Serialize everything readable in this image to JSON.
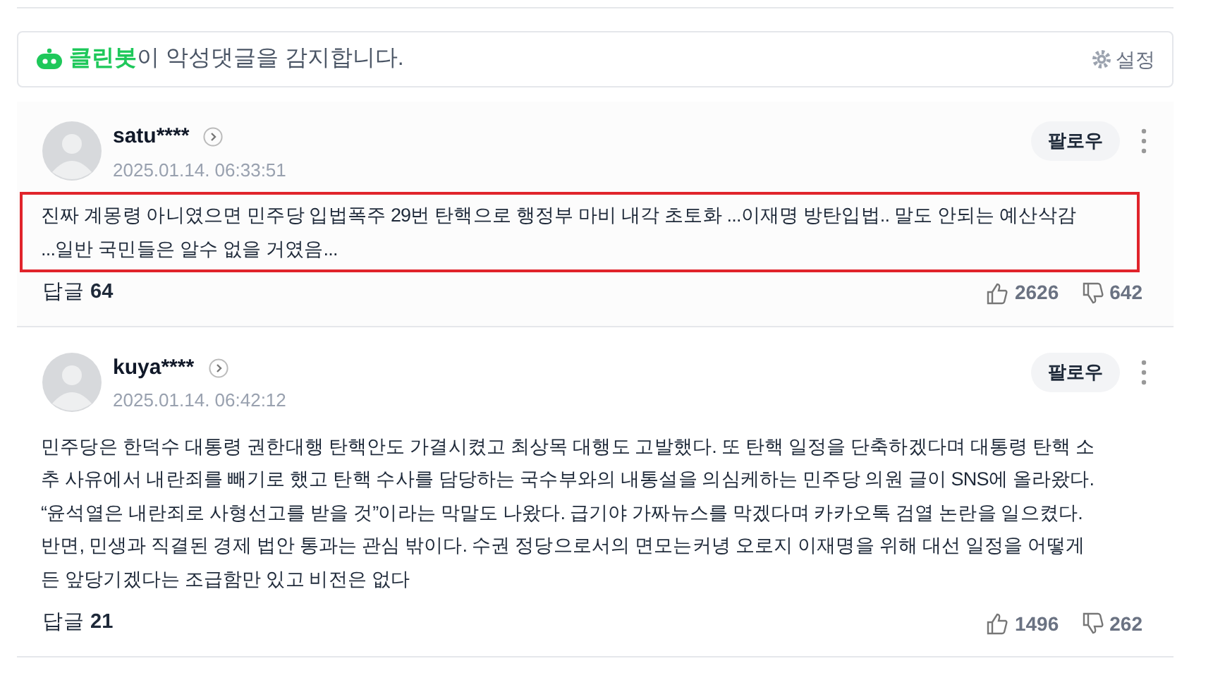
{
  "banner": {
    "brand": "클린봇",
    "message": "이 악성댓글을 감지합니다.",
    "settings": "설정"
  },
  "comments": [
    {
      "user": "satu****",
      "date": "2025.01.14. 06:33:51",
      "follow": "팔로우",
      "highlighted": true,
      "text": "진짜 계몽령 아니였으면 민주당 입법폭주 29번 탄핵으로 행정부 마비 내각 초토화 ...이재명 방탄입법.. 말도 안되는 예산삭감\n...일반 국민들은 알수 없을 거였음...",
      "reply_label": "답글",
      "reply_count": "64",
      "likes": "2626",
      "dislikes": "642"
    },
    {
      "user": "kuya****",
      "date": "2025.01.14. 06:42:12",
      "follow": "팔로우",
      "highlighted": false,
      "text": "민주당은 한덕수 대통령 권한대행 탄핵안도 가결시켰고 최상목 대행도 고발했다. 또 탄핵 일정을 단축하겠다며 대통령 탄핵 소\n추 사유에서 내란죄를 빼기로 했고 탄핵 수사를 담당하는 국수부와의 내통설을 의심케하는 민주당 의원 글이 SNS에 올라왔다.\n“윤석열은 내란죄로 사형선고를 받을 것”이라는 막말도 나왔다. 급기야 가짜뉴스를 막겠다며 카카오톡 검열 논란을 일으켰다.\n반면, 민생과 직결된 경제 법안 통과는 관심 밖이다. 수권 정당으로서의 면모는커녕 오로지 이재명을 위해 대선 일정을 어떻게\n든 앞당기겠다는 조급함만 있고 비전은 없다",
      "reply_label": "답글",
      "reply_count": "21",
      "likes": "1496",
      "dislikes": "262"
    }
  ]
}
